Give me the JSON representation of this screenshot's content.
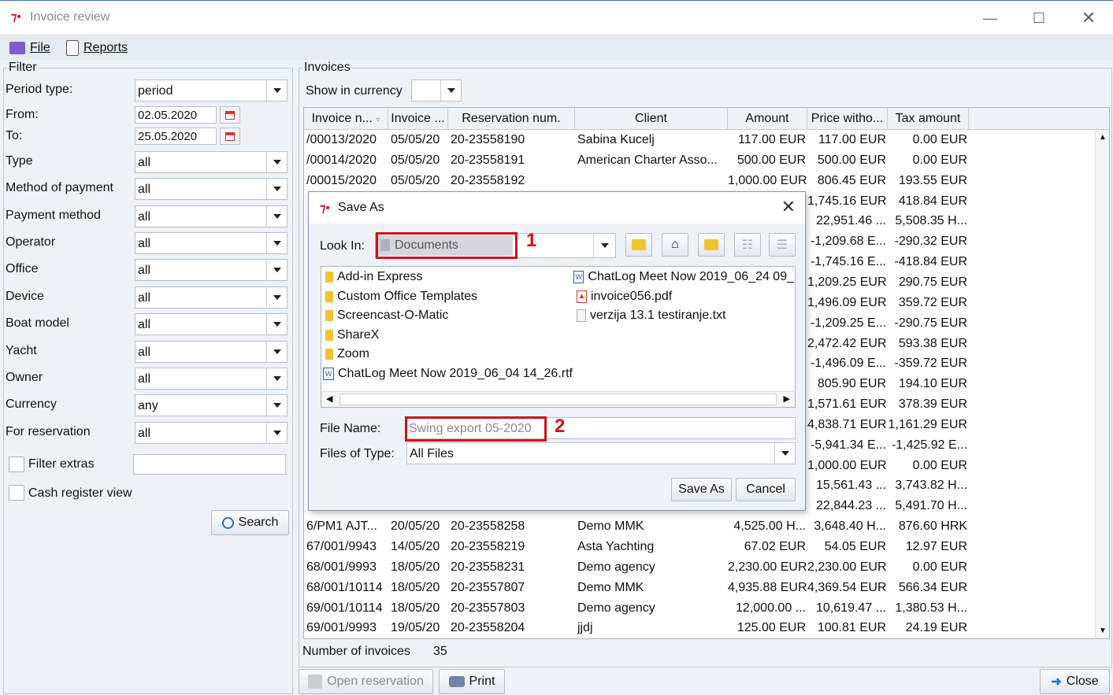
{
  "window": {
    "title": "Invoice review"
  },
  "menu": {
    "file": "File",
    "reports": "Reports"
  },
  "filter": {
    "title": "Filter",
    "period_type": {
      "label": "Period type:",
      "value": "period"
    },
    "from": {
      "label": "From:",
      "value": "02.05.2020"
    },
    "to": {
      "label": "To:",
      "value": "25.05.2020"
    },
    "rows": [
      {
        "label": "Type",
        "value": "all"
      },
      {
        "label": "Method of payment",
        "value": "all"
      },
      {
        "label": "Payment method",
        "value": "all"
      },
      {
        "label": "Operator",
        "value": "all"
      },
      {
        "label": "Office",
        "value": "all"
      },
      {
        "label": "Device",
        "value": "all"
      },
      {
        "label": "Boat model",
        "value": "all"
      },
      {
        "label": "Yacht",
        "value": "all"
      },
      {
        "label": "Owner",
        "value": "all"
      },
      {
        "label": "Currency",
        "value": "any"
      },
      {
        "label": "For reservation",
        "value": "all"
      }
    ],
    "filter_extras": "Filter extras",
    "cash_register_view": "Cash register view",
    "search_button": "Search"
  },
  "invoices": {
    "title": "Invoices",
    "show_in_currency": "Show in currency",
    "columns": [
      "Invoice n...",
      "Invoice ...",
      "Reservation num.",
      "Client",
      "Amount",
      "Price witho...",
      "Tax amount"
    ],
    "rows": [
      [
        "/00013/2020",
        "05/05/20",
        "20-23558190",
        "Sabina Kucelj",
        "117.00 EUR",
        "117.00 EUR",
        "0.00 EUR"
      ],
      [
        "/00014/2020",
        "05/05/20",
        "20-23558191",
        "American Charter Asso...",
        "500.00 EUR",
        "500.00 EUR",
        "0.00 EUR"
      ],
      [
        "/00015/2020",
        "05/05/20",
        "20-23558192",
        "",
        "1,000.00 EUR",
        "806.45 EUR",
        "193.55 EUR"
      ],
      [
        "",
        "",
        "",
        "",
        "",
        "1,745.16 EUR",
        "418.84 EUR"
      ],
      [
        "",
        "",
        "",
        "",
        "",
        "22,951.46 ...",
        "5,508.35 H..."
      ],
      [
        "",
        "",
        "",
        "",
        "",
        "-1,209.68 E...",
        "-290.32 EUR"
      ],
      [
        "",
        "",
        "",
        "",
        "",
        "-1,745.16 E...",
        "-418.84 EUR"
      ],
      [
        "",
        "",
        "",
        "",
        "",
        "1,209.25 EUR",
        "290.75 EUR"
      ],
      [
        "",
        "",
        "",
        "",
        "",
        "1,496.09 EUR",
        "359.72 EUR"
      ],
      [
        "",
        "",
        "",
        "",
        "",
        "-1,209.25 E...",
        "-290.75 EUR"
      ],
      [
        "",
        "",
        "",
        "",
        "",
        "2,472.42 EUR",
        "593.38 EUR"
      ],
      [
        "",
        "",
        "",
        "",
        "",
        "-1,496.09 E...",
        "-359.72 EUR"
      ],
      [
        "",
        "",
        "",
        "",
        "",
        "805.90 EUR",
        "194.10 EUR"
      ],
      [
        "",
        "",
        "",
        "",
        "",
        "1,571.61 EUR",
        "378.39 EUR"
      ],
      [
        "",
        "",
        "",
        "",
        "",
        "4,838.71 EUR",
        "1,161.29 EUR"
      ],
      [
        "",
        "",
        "",
        "",
        "",
        "-5,941.34 E...",
        "-1,425.92 E..."
      ],
      [
        "",
        "",
        "",
        "",
        "",
        "1,000.00 EUR",
        "0.00 EUR"
      ],
      [
        "",
        "",
        "",
        "",
        "",
        "15,561.43 ...",
        "3,743.82 H..."
      ],
      [
        "",
        "",
        "",
        "",
        "",
        "22,844.23 ...",
        "5,491.70 H..."
      ],
      [
        "6/PM1 AJT...",
        "20/05/20",
        "20-23558258",
        "Demo MMK",
        "4,525.00 H...",
        "3,648.40 H...",
        "876.60 HRK"
      ],
      [
        "67/001/9943",
        "14/05/20",
        "20-23558219",
        "Asta Yachting",
        "67.02 EUR",
        "54.05 EUR",
        "12.97 EUR"
      ],
      [
        "68/001/9993",
        "18/05/20",
        "20-23558231",
        "Demo agency",
        "2,230.00 EUR",
        "2,230.00 EUR",
        "0.00 EUR"
      ],
      [
        "68/001/10114",
        "18/05/20",
        "20-23557807",
        "Demo MMK",
        "4,935.88 EUR",
        "4,369.54 EUR",
        "566.34 EUR"
      ],
      [
        "69/001/10114",
        "18/05/20",
        "20-23557803",
        "Demo agency",
        "12,000.00 ...",
        "10,619.47 ...",
        "1,380.53 H..."
      ],
      [
        "69/001/9993",
        "19/05/20",
        "20-23558204",
        "jjdj",
        "125.00 EUR",
        "100.81 EUR",
        "24.19 EUR"
      ]
    ],
    "count_label": "Number of invoices",
    "count_value": "35"
  },
  "buttons": {
    "open_reservation": "Open reservation",
    "print": "Print",
    "close": "Close"
  },
  "dialog": {
    "title": "Save As",
    "look_in_label": "Look In:",
    "look_in_value": "Documents",
    "files": [
      {
        "name": "Add-in Express",
        "type": "folder"
      },
      {
        "name": "Custom Office Templates",
        "type": "folder"
      },
      {
        "name": "Screencast-O-Matic",
        "type": "folder"
      },
      {
        "name": "ShareX",
        "type": "folder"
      },
      {
        "name": "Zoom",
        "type": "folder"
      },
      {
        "name": "ChatLog Meet Now 2019_06_04 14_26.rtf",
        "type": "word"
      },
      {
        "name": "ChatLog Meet Now 2019_06_24 09_",
        "type": "word"
      },
      {
        "name": "invoice056.pdf",
        "type": "pdf"
      },
      {
        "name": "verzija 13.1 testiranje.txt",
        "type": "txt"
      }
    ],
    "file_name_label": "File Name:",
    "file_name_value": "Swing export 05-2020",
    "files_of_type_label": "Files of Type:",
    "files_of_type_value": "All Files",
    "save_button": "Save As",
    "cancel_button": "Cancel",
    "callouts": [
      "1",
      "2"
    ]
  }
}
